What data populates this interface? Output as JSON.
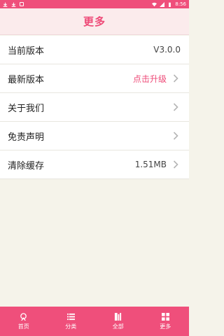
{
  "status_bar": {
    "time": "8:56"
  },
  "header": {
    "title": "更多"
  },
  "rows": [
    {
      "label": "当前版本",
      "value": "V3.0.0"
    },
    {
      "label": "最新版本",
      "value": "点击升级"
    },
    {
      "label": "关于我们",
      "value": ""
    },
    {
      "label": "免责声明",
      "value": ""
    },
    {
      "label": "清除缓存",
      "value": "1.51MB"
    }
  ],
  "tabs": [
    {
      "label": "首页",
      "icon": "home-icon"
    },
    {
      "label": "分类",
      "icon": "list-icon"
    },
    {
      "label": "全部",
      "icon": "book-icon"
    },
    {
      "label": "更多",
      "icon": "grid-icon"
    }
  ],
  "colors": {
    "accent": "#ee4b78",
    "tabbar": "#ef4f7b",
    "background": "#f5f3ea"
  }
}
